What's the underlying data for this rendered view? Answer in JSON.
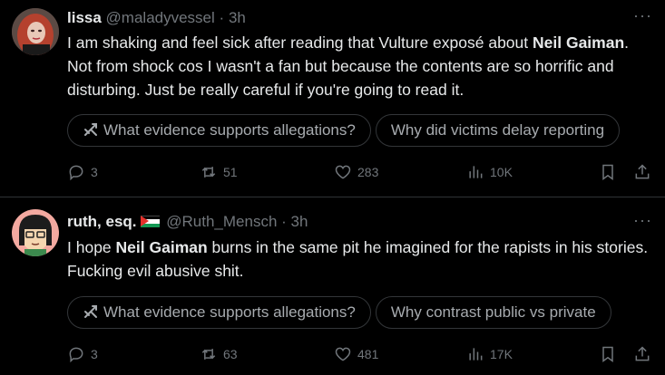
{
  "posts": [
    {
      "name": "lissa",
      "handle": "@maladyvessel",
      "separator": "·",
      "time": "3h",
      "more": "···",
      "text_parts": [
        "I am shaking and feel sick after reading that Vulture exposé about ",
        "Neil Gaiman",
        ". Not from shock cos I wasn't a fan but because the contents are so horrific and disturbing. Just be really careful if you're going to read it."
      ],
      "chips": [
        "What evidence supports allegations?",
        "Why did victims delay reporting"
      ],
      "replies": "3",
      "reposts": "51",
      "likes": "283",
      "views": "10K"
    },
    {
      "name": "ruth, esq.",
      "handle": "@Ruth_Mensch",
      "separator": "·",
      "time": "3h",
      "more": "···",
      "text_parts": [
        "I hope ",
        "Neil Gaiman",
        " burns in the same pit he imagined for the rapists in his stories. Fucking evil abusive shit."
      ],
      "chips": [
        "What evidence supports allegations?",
        "Why contrast public vs private"
      ],
      "replies": "3",
      "reposts": "63",
      "likes": "481",
      "views": "17K"
    }
  ],
  "icons": {
    "reply": "speech-bubble-icon",
    "repost": "repost-arrows-icon",
    "like": "heart-icon",
    "views": "bar-chart-icon",
    "bookmark": "bookmark-icon",
    "share": "share-icon",
    "grok": "grok-icon",
    "flag": "palestine-flag-icon"
  },
  "colors": {
    "background": "#000000",
    "text": "#e7e9ea",
    "secondary": "#71767b",
    "border": "#2f3336"
  }
}
